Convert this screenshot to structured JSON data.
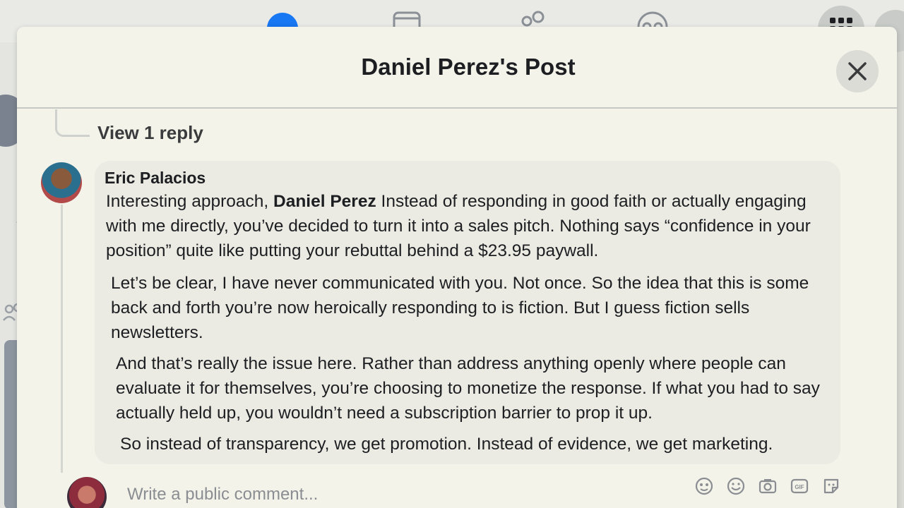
{
  "modal": {
    "title": "Daniel Perez's Post"
  },
  "thread": {
    "view_replies_label": "View 1 reply"
  },
  "comment": {
    "author": "Eric Palacios",
    "mention": "Daniel Perez",
    "p1_before": "Interesting approach, ",
    "p1_after": " Instead of responding in good faith or actually engaging with me directly, you’ve decided to turn it into a sales pitch. Nothing says “confidence in your position” quite like putting your rebuttal behind a $23.95 paywall.",
    "p2": "Let’s be clear, I have never communicated with you. Not once. So the idea that this is some back and forth you’re now heroically responding to is fiction. But I guess fiction sells newsletters.",
    "p3": "And that’s really the issue here. Rather than address anything openly where people can evaluate it for themselves, you’re choosing to monetize the response. If what you had to say actually held up, you wouldn’t need a subscription barrier to prop it up.",
    "p4": "So instead of transparency, we get promotion. Instead of evidence, we get marketing."
  },
  "composer": {
    "placeholder": "Write a public comment...",
    "tools": [
      "avatar-sticker-icon",
      "emoji-icon",
      "camera-icon",
      "gif-icon",
      "sticker-icon"
    ]
  },
  "nav_icons": [
    "home-icon",
    "video-icon",
    "friends-icon",
    "groups-icon",
    "menu-grid-icon",
    "messenger-icon"
  ],
  "colors": {
    "accent": "#1877f2",
    "modal_bg": "#f3f3ea",
    "bubble_bg": "#ebebe3",
    "text": "#1c1e21",
    "muted": "#8a8d91"
  }
}
